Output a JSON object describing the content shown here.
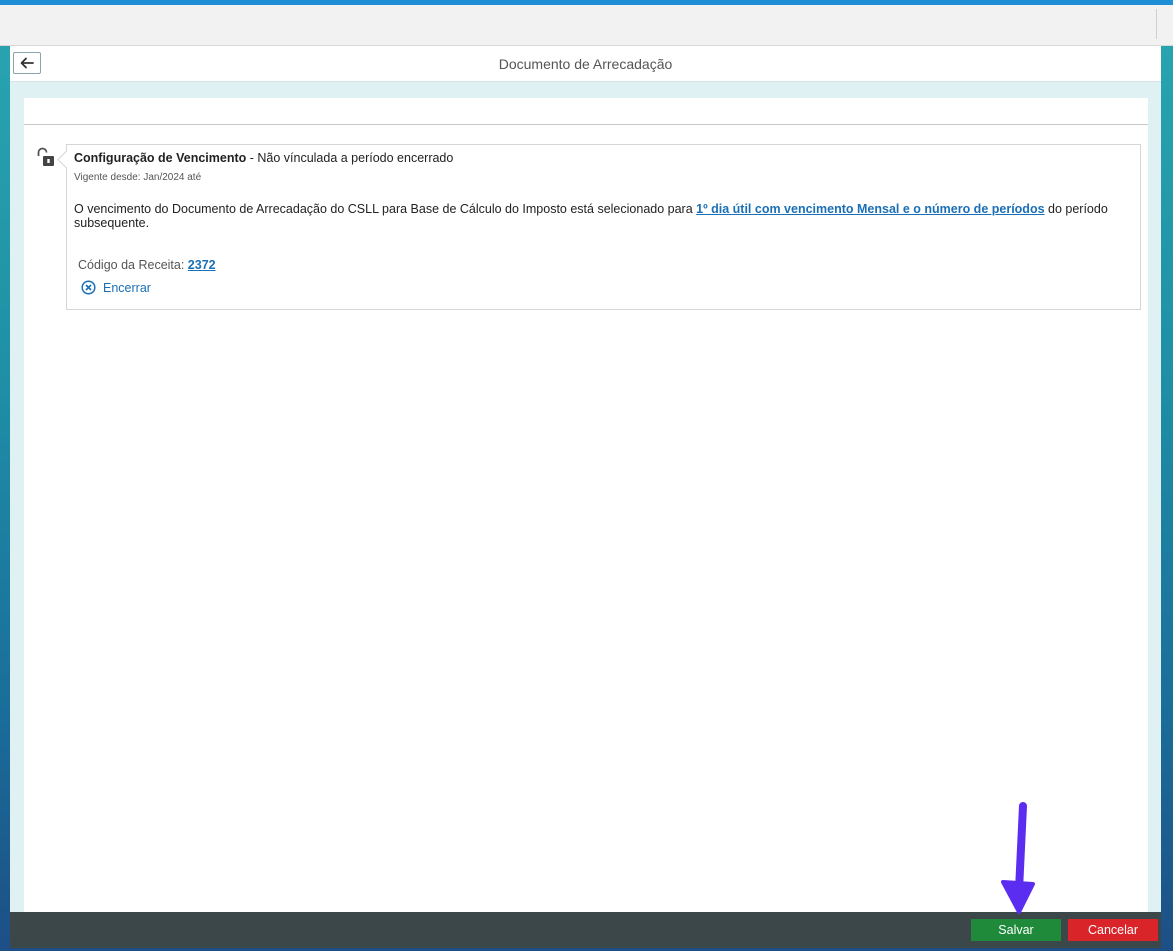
{
  "window": {
    "title": "Documento de Arrecadação"
  },
  "card": {
    "title_bold": "Configuração de Vencimento",
    "title_rest": " - Não vínculada a período encerrado",
    "subtitle": "Vigente desde: Jan/2024 até",
    "desc_prefix": "O vencimento do Documento de Arrecadação do CSLL para Base de Cálculo do Imposto está selecionado para ",
    "desc_link": "1º dia útil com vencimento Mensal e o número de períodos",
    "desc_suffix": " do período subsequente.",
    "codigo_label": "Código da Receita: ",
    "codigo_value": "2372",
    "encerrar_label": "Encerrar"
  },
  "footer": {
    "save_label": "Salvar",
    "cancel_label": "Cancelar"
  },
  "colors": {
    "accent": "#1a6fb6",
    "save": "#1f8a3a",
    "cancel": "#d9242a",
    "arrow": "#5b2df0"
  },
  "icons": {
    "back": "arrow-left-icon",
    "lock": "lock-open-icon",
    "encerrar": "close-circle-icon"
  }
}
